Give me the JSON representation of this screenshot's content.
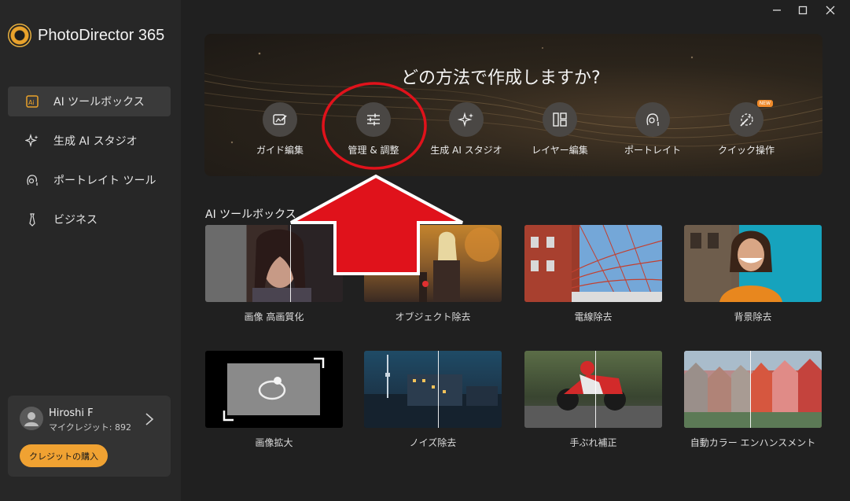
{
  "app": {
    "name": "PhotoDirector 365"
  },
  "sidebar": {
    "items": [
      {
        "label": "AI ツールボックス",
        "icon": "ai-toolbox-icon",
        "active": true
      },
      {
        "label": "生成 AI スタジオ",
        "icon": "sparkle-icon",
        "active": false
      },
      {
        "label": "ポートレイト ツール",
        "icon": "portrait-icon",
        "active": false
      },
      {
        "label": "ビジネス",
        "icon": "tie-icon",
        "active": false
      }
    ]
  },
  "user": {
    "name": "Hiroshi F",
    "credits": "マイクレジット: 892",
    "buy_label": "クレジットの購入"
  },
  "hero": {
    "title": "どの方法で作成しますか?",
    "modes": [
      {
        "label": "ガイド編集",
        "icon": "guided-edit-icon"
      },
      {
        "label": "管理 & 調整",
        "icon": "sliders-icon"
      },
      {
        "label": "生成 AI スタジオ",
        "icon": "sparkle-icon"
      },
      {
        "label": "レイヤー編集",
        "icon": "layers-icon"
      },
      {
        "label": "ポートレイト",
        "icon": "portrait-icon"
      },
      {
        "label": "クイック操作",
        "icon": "magic-wand-icon",
        "badge": "NEW"
      }
    ]
  },
  "section": {
    "title": "AI ツールボックス",
    "cards": [
      {
        "label": "画像 高画質化"
      },
      {
        "label": "オブジェクト除去"
      },
      {
        "label": "電線除去"
      },
      {
        "label": "背景除去"
      },
      {
        "label": "画像拡大"
      },
      {
        "label": "ノイズ除去"
      },
      {
        "label": "手ぶれ補正"
      },
      {
        "label": "自動カラー エンハンスメント"
      }
    ]
  },
  "colors": {
    "accent": "#f0a232",
    "annotation_red": "#e0121b"
  }
}
